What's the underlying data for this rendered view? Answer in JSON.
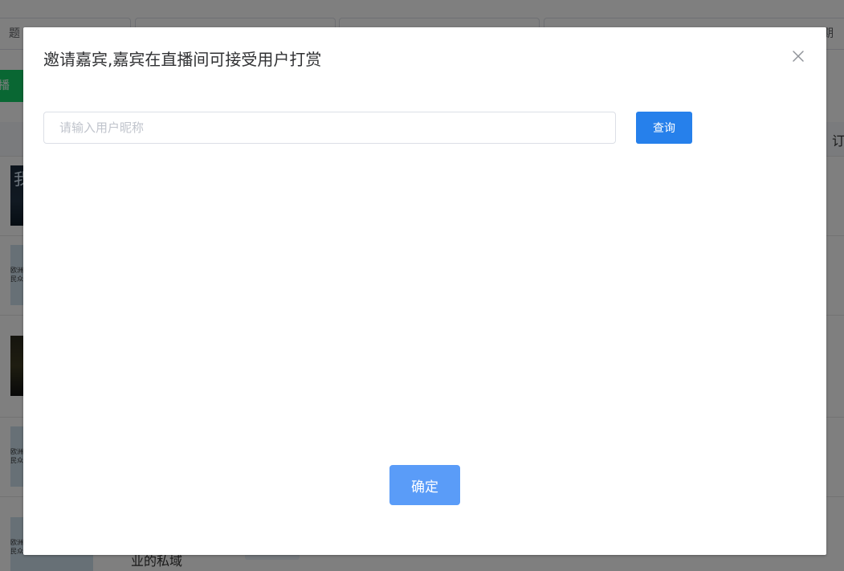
{
  "background": {
    "filters": [
      {
        "text": "题"
      },
      {
        "text": ""
      },
      {
        "text": ""
      },
      {
        "text": "期"
      }
    ],
    "green_button": "播",
    "column_header_right": "订",
    "row_title": "业的私域",
    "thumbnails": [
      {
        "text": "我"
      },
      {
        "text": "欧洲\n民众"
      },
      {
        "text": ""
      },
      {
        "text": "欧洲\n民众"
      },
      {
        "text": "欧洲\n民众"
      }
    ]
  },
  "dialog": {
    "title": "邀请嘉宾,嘉宾在直播间可接受用户打赏",
    "close_icon": "close-icon",
    "search": {
      "value": "",
      "placeholder": "请输入用户昵称"
    },
    "query_label": "查询",
    "confirm_label": "确定"
  },
  "colors": {
    "primary": "#2680eb",
    "confirm": "#5a9cf8",
    "overlay": "rgba(0,0,0,0.5)",
    "green": "#13ce66"
  }
}
